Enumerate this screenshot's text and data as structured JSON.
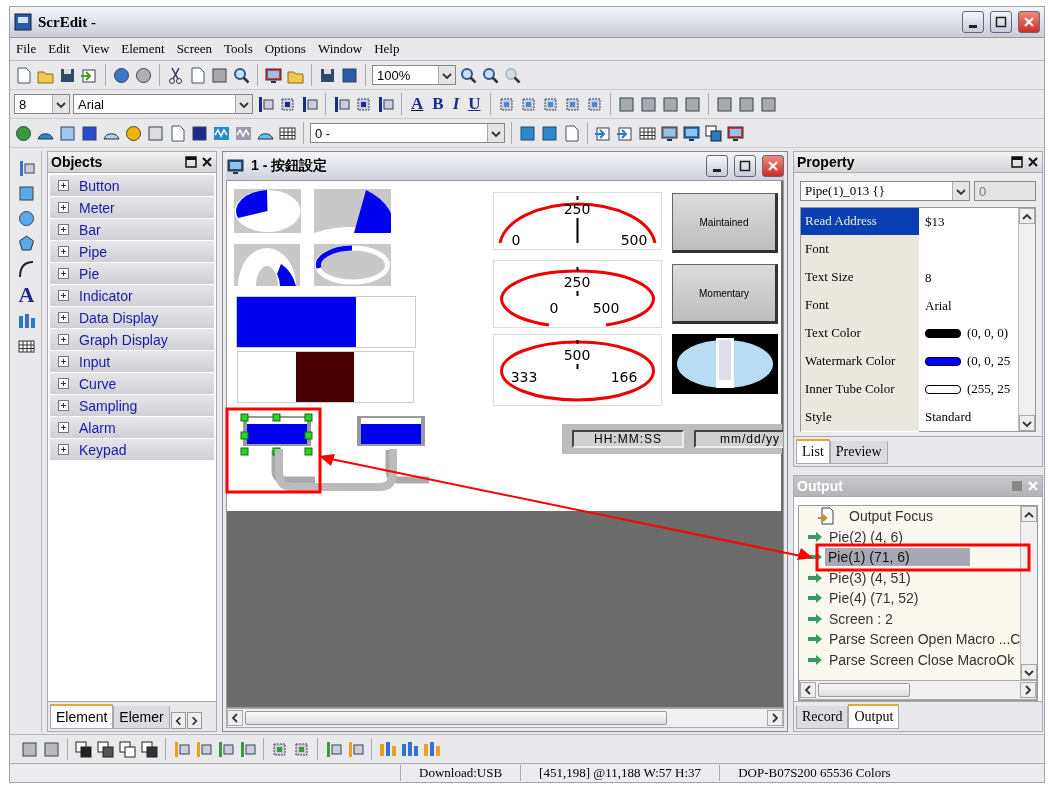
{
  "window": {
    "title": "ScrEdit -"
  },
  "menu": [
    "File",
    "Edit",
    "View",
    "Element",
    "Screen",
    "Tools",
    "Options",
    "Window",
    "Help"
  ],
  "toolbar": {
    "zoom": "100%",
    "font_size": "8",
    "font_name": "Arial",
    "font_color_glyph": "A",
    "style_glyphs": [
      "B",
      "I",
      "U"
    ],
    "element_combo": "0 -"
  },
  "drawing_tools": {
    "text_glyph": "A"
  },
  "objects_panel": {
    "title": "Objects",
    "items": [
      {
        "label": "Button",
        "expanded": false
      },
      {
        "label": "Meter",
        "expanded": false
      },
      {
        "label": "Bar",
        "expanded": false
      },
      {
        "label": "Pipe",
        "expanded": false
      },
      {
        "label": "Pie",
        "expanded": false
      },
      {
        "label": "Indicator",
        "expanded": false
      },
      {
        "label": "Data Display",
        "expanded": false
      },
      {
        "label": "Graph Display",
        "expanded": false
      },
      {
        "label": "Input",
        "expanded": false
      },
      {
        "label": "Curve",
        "expanded": false
      },
      {
        "label": "Sampling",
        "expanded": false
      },
      {
        "label": "Alarm",
        "expanded": false
      },
      {
        "label": "Keypad",
        "expanded": false
      }
    ],
    "tabs": [
      {
        "label": "Element",
        "selected": true
      },
      {
        "label": "Elemer",
        "selected": false
      }
    ]
  },
  "editor": {
    "title": "1 - 按鈕設定",
    "bar": {
      "level": 0.67
    },
    "pipes": [
      {
        "selected": true
      },
      {
        "selected": false
      }
    ],
    "gauges": [
      {
        "kind": "top-arc",
        "labels": [
          "250",
          "0",
          "500"
        ]
      },
      {
        "kind": "open-ellipse",
        "labels": [
          "250",
          "0",
          "500"
        ]
      },
      {
        "kind": "full-ellipse",
        "labels": [
          "500",
          "333",
          "166"
        ]
      }
    ],
    "buttons": [
      "Maintained",
      "Momentary"
    ],
    "clock_fields": [
      "HH:MM:SS",
      "mm/dd/yy"
    ]
  },
  "property_panel": {
    "title": "Property",
    "object": "Pipe(1)_013 {}",
    "spin": {
      "value": "0",
      "disabled": true
    },
    "rows": [
      {
        "name": "Read Address",
        "value": "$13",
        "selected": true
      },
      {
        "name": "Font",
        "selected": false
      },
      {
        "name": "Text Size",
        "value": "8",
        "selected": false
      },
      {
        "name": "Font",
        "value": "Arial",
        "selected": false
      },
      {
        "name": "Text Color",
        "color": "#000000",
        "value": "(0, 0, 0)",
        "selected": false
      },
      {
        "name": "Watermark Color",
        "color": "#0000ff",
        "value": "(0, 0, 25",
        "selected": false
      },
      {
        "name": "Inner Tube Color",
        "color": "#ffffff",
        "value": "(255, 25",
        "selected": false
      },
      {
        "name": "Style",
        "value": "Standard",
        "selected": false
      }
    ],
    "tabs": [
      {
        "label": "List",
        "selected": true
      },
      {
        "label": "Preview",
        "selected": false
      }
    ]
  },
  "output_panel": {
    "title": "Output",
    "items": [
      {
        "kind": "focus",
        "text": "Output Focus",
        "selected": false
      },
      {
        "kind": "message",
        "text": "Pie(2) (4, 6)",
        "selected": false
      },
      {
        "kind": "message",
        "text": "Pie(1) (71, 6)",
        "selected": true
      },
      {
        "kind": "message",
        "text": "Pie(3) (4, 51)",
        "selected": false
      },
      {
        "kind": "message",
        "text": "Pie(4) (71, 52)",
        "selected": false
      },
      {
        "kind": "message",
        "text": "Screen : 2",
        "selected": false
      },
      {
        "kind": "message",
        "text": "Parse Screen Open Macro ...C",
        "selected": false
      },
      {
        "kind": "message",
        "text": "Parse Screen Close MacroOk",
        "selected": false
      }
    ],
    "tabs": [
      {
        "label": "Record",
        "selected": false
      },
      {
        "label": "Output",
        "selected": true
      }
    ]
  },
  "status_bar": [
    "Download:USB",
    "[451,198] @11,188 W:57 H:37",
    "DOP-B07S200 65536 Colors"
  ]
}
